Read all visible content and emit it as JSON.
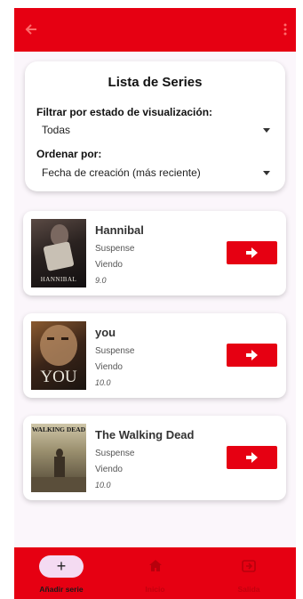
{
  "appbar": {
    "back_icon": "arrow-left-icon",
    "menu_icon": "more-vertical-icon",
    "color": "#e60012"
  },
  "filter": {
    "title": "Lista de Series",
    "status_label": "Filtrar por estado de visualización:",
    "status_value": "Todas",
    "sort_label": "Ordenar por:",
    "sort_value": "Fecha de creación (más reciente)"
  },
  "series": [
    {
      "title": "Hannibal",
      "genre": "Suspense",
      "status": "Viendo",
      "rating": "9.0",
      "poster_caption": "HANNIBAL"
    },
    {
      "title": "you",
      "genre": "Suspense",
      "status": "Viendo",
      "rating": "10.0",
      "poster_caption": "YOU"
    },
    {
      "title": "The Walking Dead",
      "genre": "Suspense",
      "status": "Viendo",
      "rating": "10.0",
      "poster_caption": "WALKING DEAD"
    }
  ],
  "nav": {
    "add": {
      "label": "Añadir serie",
      "icon": "plus-icon"
    },
    "home": {
      "label": "Inicio",
      "icon": "home-icon"
    },
    "exit": {
      "label": "Salida",
      "icon": "exit-icon"
    }
  }
}
